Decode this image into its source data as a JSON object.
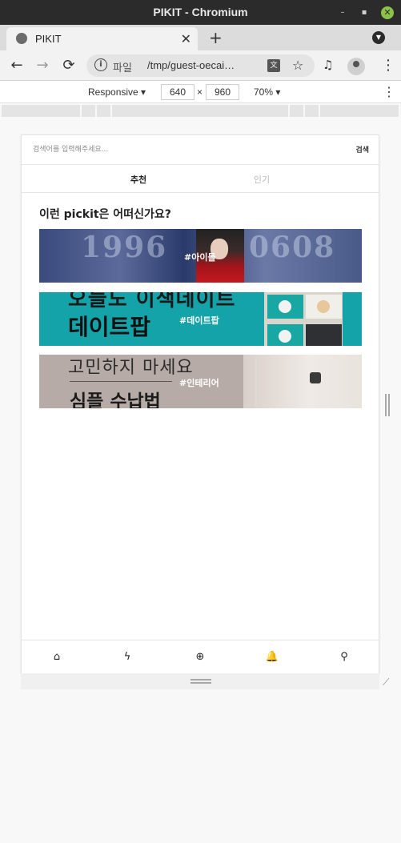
{
  "window": {
    "title": "PIKIT - Chromium",
    "min_icon": "–",
    "max_icon": "▪",
    "close_icon": "✕"
  },
  "tab": {
    "title": "PIKIT",
    "close": "✕"
  },
  "tabstrip": {
    "new_tab": "+",
    "menu": "▼"
  },
  "toolbar": {
    "back": "←",
    "forward": "→",
    "reload": "⟳",
    "info_icon": "i",
    "scheme_label": "파일",
    "url": "/tmp/guest-oecai…",
    "translate_icon": "文",
    "star_icon": "☆",
    "media_icon": "♫",
    "menu_icon": "⋮"
  },
  "devtools": {
    "mode": "Responsive ▾",
    "width": "640",
    "times": "×",
    "height": "960",
    "zoom": "70% ▾",
    "more": "⋮"
  },
  "app": {
    "search": {
      "placeholder": "검색어를 입력해주세요...",
      "button": "검색"
    },
    "tabs": [
      {
        "label": "추천",
        "active": true
      },
      {
        "label": "인기",
        "active": false
      }
    ],
    "heading": "이런 pickit은 어떠신가요?",
    "banners": [
      {
        "tag": "#아이돌",
        "line1": "1996",
        "line2": "0608"
      },
      {
        "tag": "#데이트팝",
        "line1": "오늘도 이색데이트",
        "line2": "데이트팝"
      },
      {
        "tag": "#인테리어",
        "line1": "고민하지 마세요",
        "line2": "심플 수납법"
      }
    ],
    "bottom_nav": [
      {
        "name": "home-icon",
        "glyph": "⌂"
      },
      {
        "name": "lightning-icon",
        "glyph": "ϟ"
      },
      {
        "name": "add-circle-icon",
        "glyph": "⊕"
      },
      {
        "name": "bell-icon",
        "glyph": "🔔"
      },
      {
        "name": "user-icon",
        "glyph": "⚲"
      }
    ]
  },
  "resize_corner": "⟋"
}
